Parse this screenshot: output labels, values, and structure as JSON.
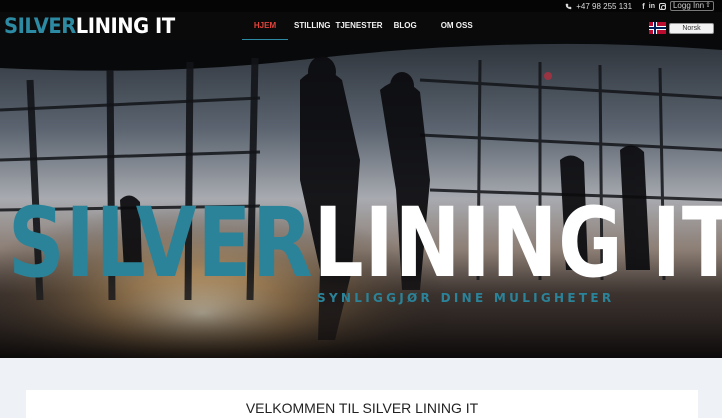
{
  "topbar": {
    "phone": "+47 98 255 131",
    "login_label": "Logg Inn",
    "icons": [
      "phone-icon",
      "facebook-icon",
      "linkedin-icon",
      "instagram-icon"
    ]
  },
  "header": {
    "logo_part1": "SILVER",
    "logo_part2": "LINING IT",
    "nav": [
      {
        "label": "HJEM",
        "active": true
      },
      {
        "label": "STILLING"
      },
      {
        "label": "TJENESTER"
      },
      {
        "label": "BLOG"
      },
      {
        "label": "OM OSS"
      }
    ],
    "language": "Norsk"
  },
  "hero": {
    "title_part1": "SILVER",
    "title_part2": "LINING IT",
    "tagline": "SYNLIGGJØR DINE MULIGHETER"
  },
  "main": {
    "welcome_title": "VELKOMMEN TIL SILVER LINING IT"
  },
  "colors": {
    "accent": "#2b8399",
    "active_nav": "#e0443c",
    "header_bg": "#0a0a0a"
  }
}
